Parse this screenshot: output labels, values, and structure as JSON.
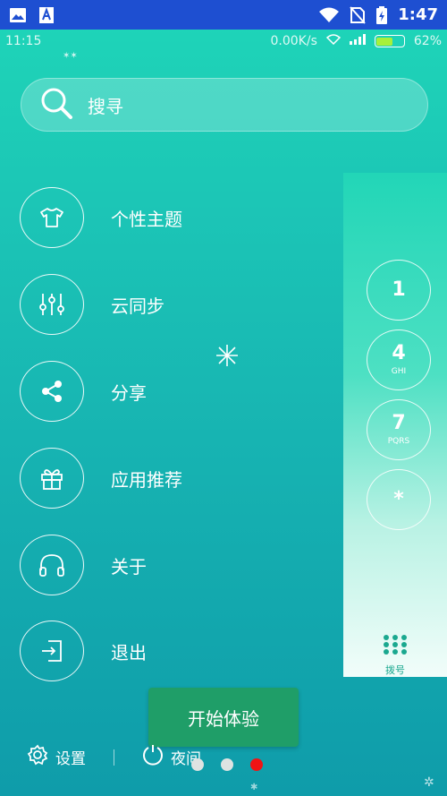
{
  "system_bar": {
    "time": "1:47"
  },
  "inner_status": {
    "time": "11:15",
    "speed": "0.00K/s",
    "battery": "62%",
    "battery_level": 0.62
  },
  "search": {
    "label": "搜寻"
  },
  "menu": {
    "items": [
      {
        "label": "个性主题",
        "icon": "tshirt-icon"
      },
      {
        "label": "云同步",
        "icon": "sliders-icon"
      },
      {
        "label": "分享",
        "icon": "share-icon"
      },
      {
        "label": "应用推荐",
        "icon": "gift-icon"
      },
      {
        "label": "关于",
        "icon": "headphones-icon"
      },
      {
        "label": "退出",
        "icon": "exit-icon"
      }
    ]
  },
  "dialer": {
    "keys": [
      {
        "num": "1",
        "sub": ""
      },
      {
        "num": "4",
        "sub": "GHI"
      },
      {
        "num": "7",
        "sub": "PQRS"
      },
      {
        "num": "*",
        "sub": ""
      }
    ],
    "tab_label": "拨号"
  },
  "cta": {
    "label": "开始体验"
  },
  "bottom": {
    "settings_label": "设置",
    "night_label": "夜间"
  },
  "pager": {
    "count": 3,
    "active": 2
  },
  "colors": {
    "accent": "#1f9e68",
    "sys_bar": "#1e4fd1",
    "active_dot": "#f01414"
  }
}
